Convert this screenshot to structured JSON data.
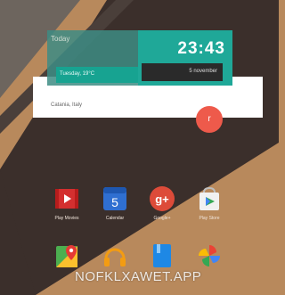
{
  "widget": {
    "today_label": "Today",
    "weather": "Tuesday, 19°C",
    "time": "23:43",
    "date": "5 november",
    "location": "Catania, Italy",
    "fab_label": "r"
  },
  "apps": [
    {
      "label": "Play Movies",
      "icon": "play-movies-icon"
    },
    {
      "label": "Calendar",
      "icon": "calendar-icon",
      "glyph_text": "5"
    },
    {
      "label": "Google+",
      "icon": "google-plus-icon",
      "glyph_text": "g+"
    },
    {
      "label": "Play Store",
      "icon": "play-store-icon"
    }
  ],
  "dock": [
    {
      "icon": "maps-icon"
    },
    {
      "icon": "headphones-icon"
    },
    {
      "icon": "books-icon"
    },
    {
      "icon": "photos-pinwheel-icon"
    }
  ],
  "watermark": "NOFKLXAWET.APP",
  "colors": {
    "wallpaper_tan": "#b8895c",
    "wallpaper_dark": "#3b2f2b",
    "accent_teal": "#1fa898",
    "fab_red": "#ee5a4b"
  }
}
